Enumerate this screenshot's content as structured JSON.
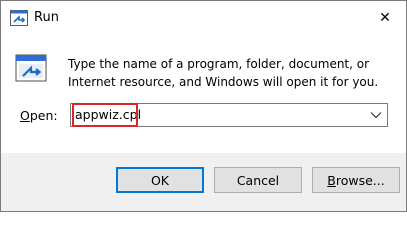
{
  "window": {
    "title": "Run",
    "close_glyph": "✕"
  },
  "icons": {
    "title": "run-dialog-icon",
    "app": "run-app-icon",
    "close": "close-icon",
    "dropdown": "chevron-down-icon"
  },
  "description": "Type the name of a program, folder, document, or Internet resource, and Windows will open it for you.",
  "open_field": {
    "label_access_key": "O",
    "label_rest": "pen:",
    "value": "appwiz.cpl"
  },
  "buttons": {
    "ok": "OK",
    "cancel": "Cancel",
    "browse_access_key": "B",
    "browse_rest": "rowse..."
  },
  "colors": {
    "accent": "#0078d7",
    "highlight": "#d9262b"
  }
}
